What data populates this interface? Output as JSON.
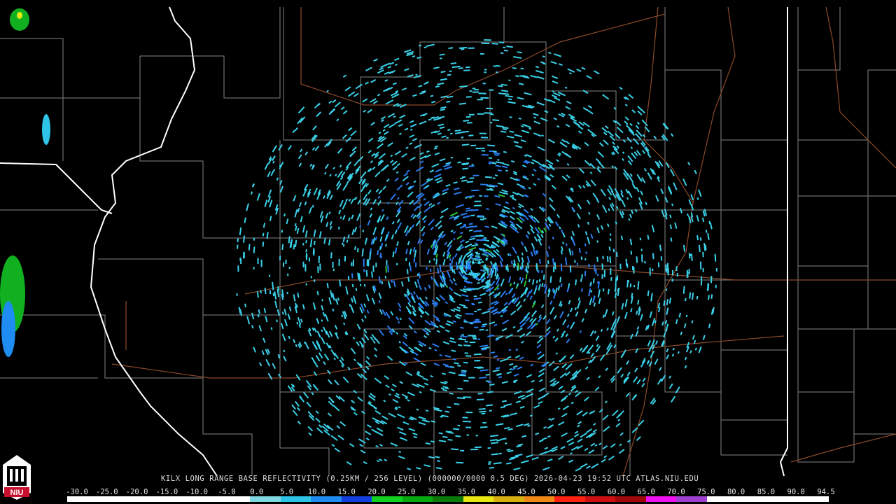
{
  "product": {
    "title": "KILX LONG RANGE BASE REFLECTIVITY (0.25KM / 256 LEVEL) (000000/0000 0.5 DEG) 2026-04-23 19:52 UTC  ATLAS.NIU.EDU"
  },
  "colorbar": {
    "ticks": [
      "-30.0",
      "-25.0",
      "-20.0",
      "-15.0",
      "-10.0",
      "-5.0",
      "0.0",
      "5.0",
      "10.0",
      "15.0",
      "20.0",
      "25.0",
      "30.0",
      "35.0",
      "40.0",
      "45.0",
      "50.0",
      "55.0",
      "60.0",
      "65.0",
      "70.0",
      "75.0",
      "80.0",
      "85.0",
      "90.0",
      "94.5"
    ],
    "colors": [
      "#ffffff",
      "#ffffff",
      "#ffffff",
      "#ffffff",
      "#ffffff",
      "#ffffff",
      "#7fd7e0",
      "#2ec4e8",
      "#1e8cf0",
      "#1240e0",
      "#10d020",
      "#08a810",
      "#0a7a08",
      "#e8e810",
      "#d8b010",
      "#f08818",
      "#ff2010",
      "#d01010",
      "#a00808",
      "#f010f0",
      "#a040d0",
      "#ffffff",
      "#ffffff",
      "#ffffff",
      "#ffffff"
    ]
  },
  "logo": {
    "text": "NIU"
  },
  "colors": {
    "background": "#000000",
    "state_border": "#ffffff",
    "county_border": "#a0a0a0",
    "highway": "#8b4a2a",
    "echo_light": "#3ad0e8",
    "echo_mid": "#2a7cf0",
    "echo_strong": "#30c030"
  }
}
